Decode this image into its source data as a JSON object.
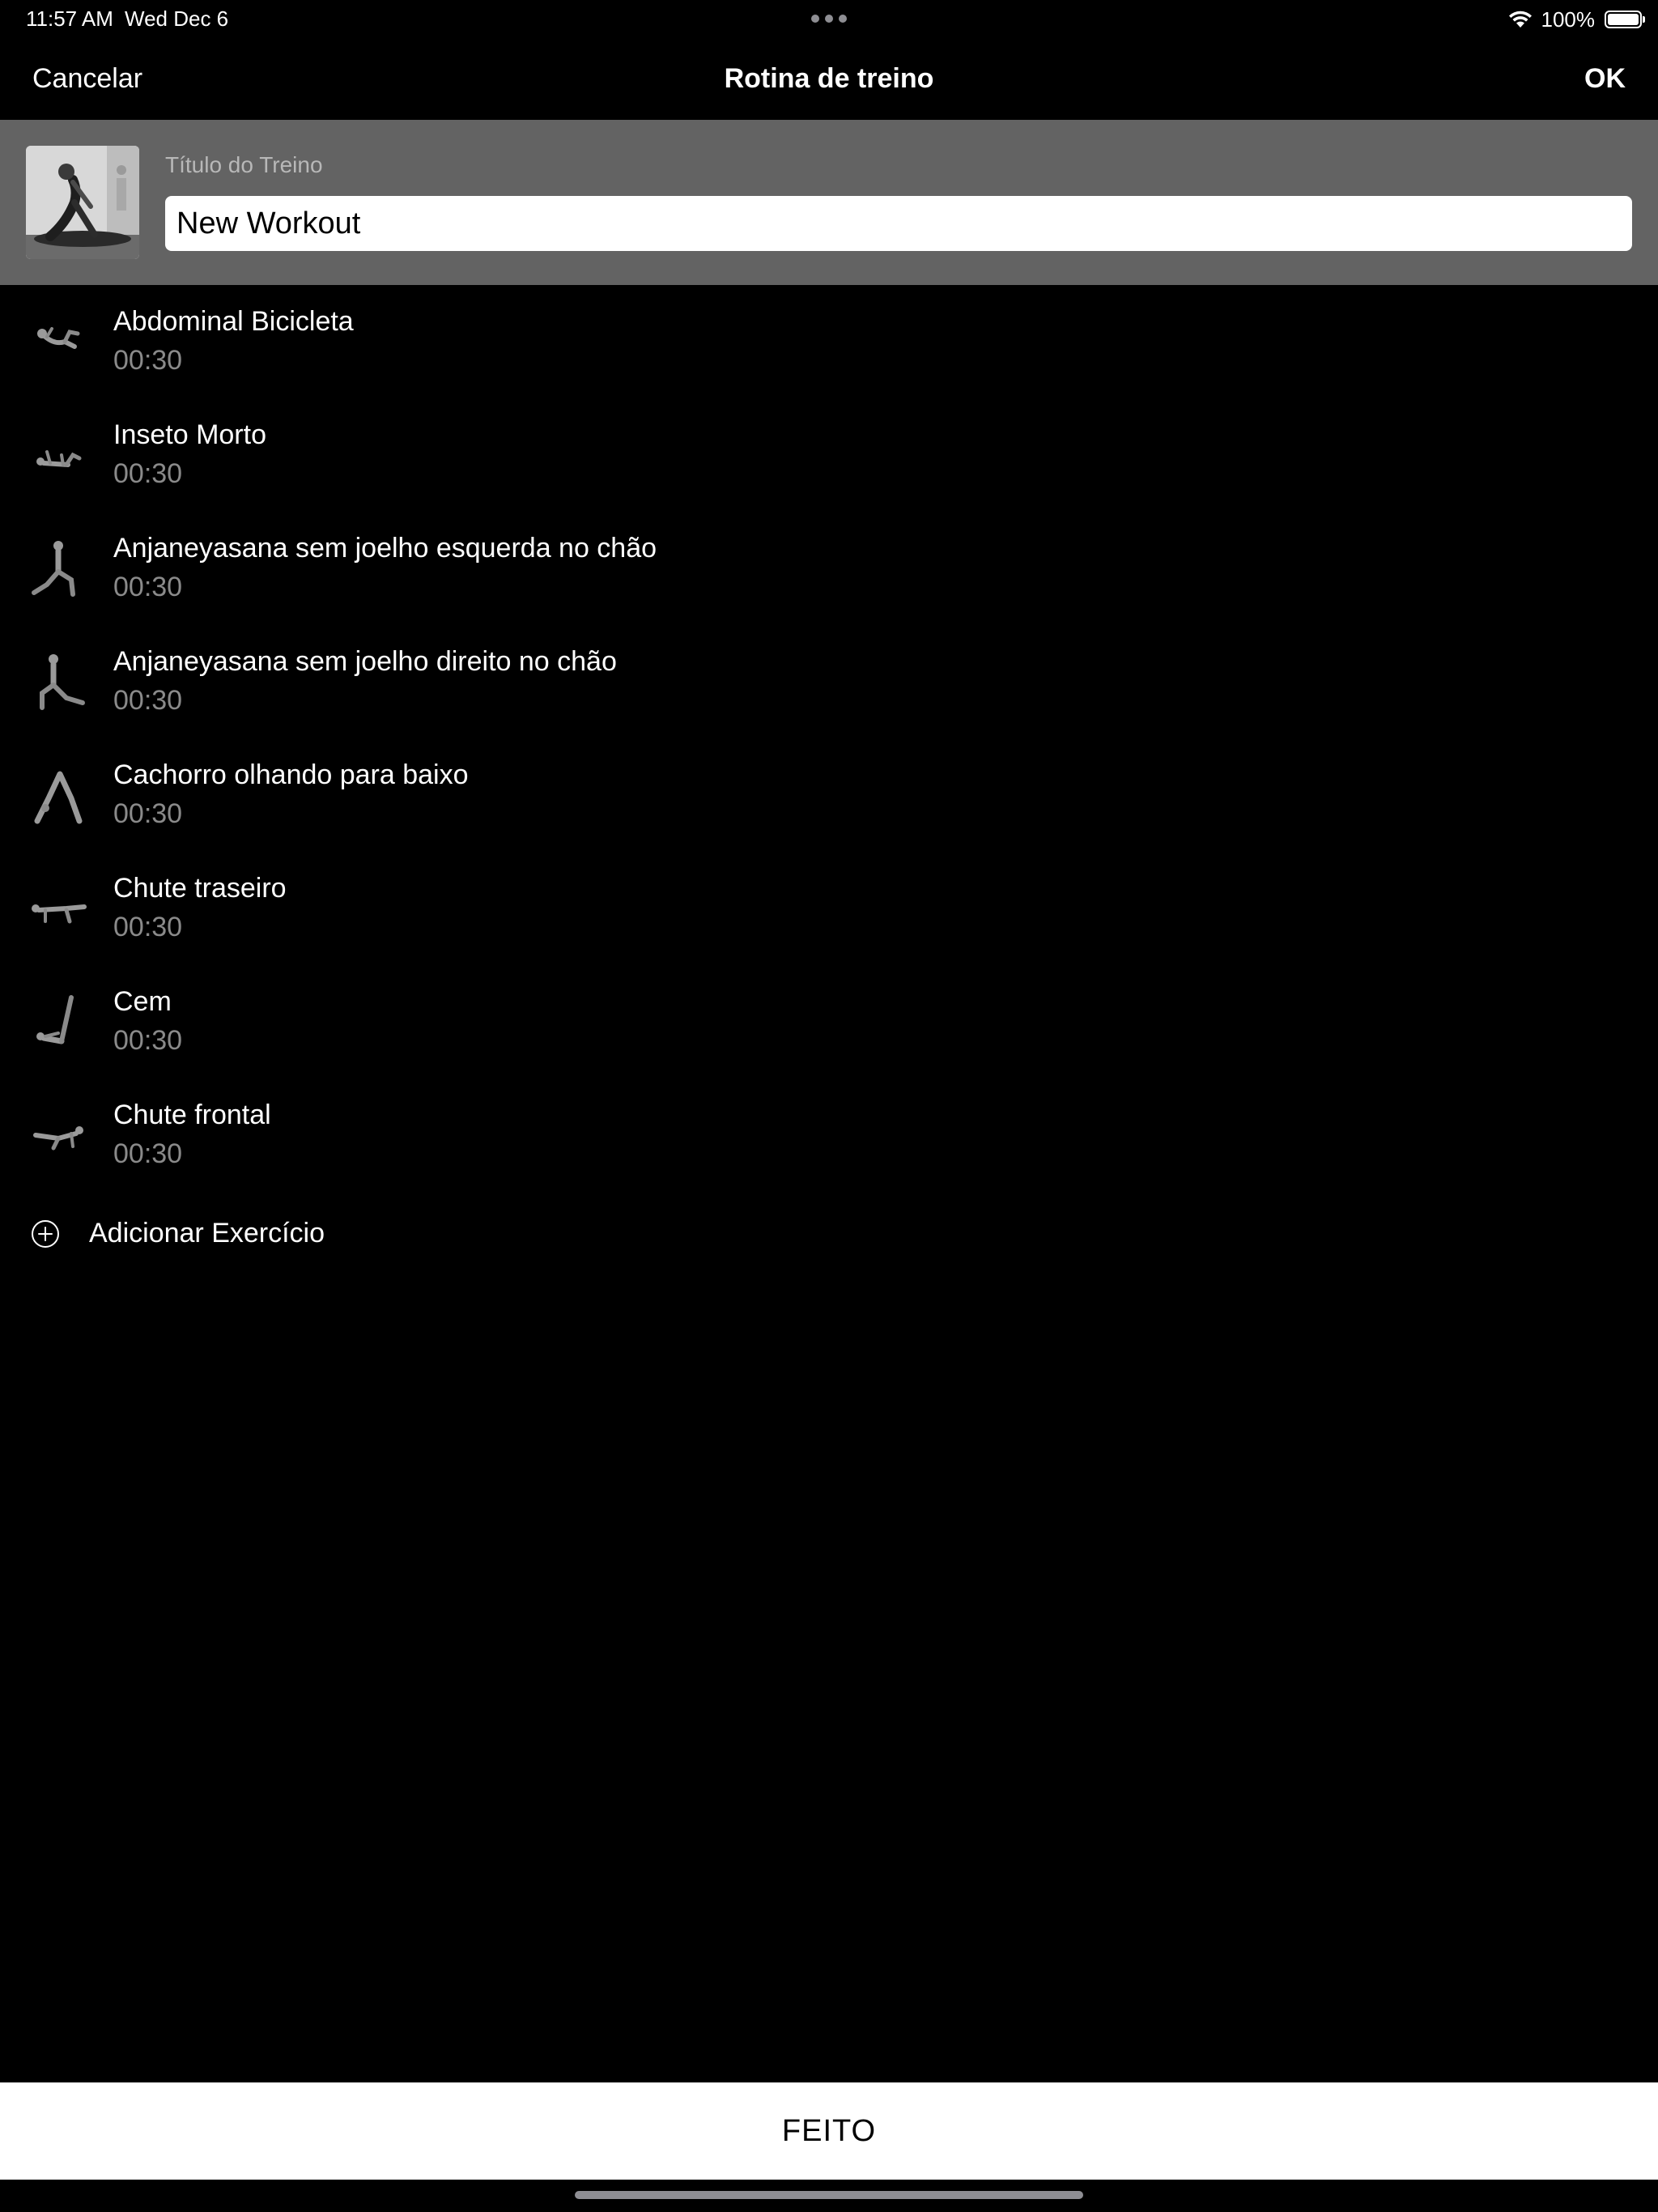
{
  "status_bar": {
    "time": "11:57 AM",
    "date": "Wed Dec 6",
    "battery_percent": "100%",
    "icons": [
      "wifi-icon",
      "battery-icon"
    ]
  },
  "nav": {
    "cancel_label": "Cancelar",
    "title": "Rotina de treino",
    "ok_label": "OK"
  },
  "header": {
    "title_label": "Título do Treino",
    "title_value": "New Workout",
    "thumbnail": "yoga-pose-image"
  },
  "exercises": [
    {
      "name": "Abdominal Bicicleta",
      "duration": "00:30",
      "icon": "bicycle-crunch-icon"
    },
    {
      "name": "Inseto Morto",
      "duration": "00:30",
      "icon": "dead-bug-icon"
    },
    {
      "name": "Anjaneyasana sem joelho esquerda no chão",
      "duration": "00:30",
      "icon": "lunge-left-icon"
    },
    {
      "name": "Anjaneyasana sem joelho direito no chão",
      "duration": "00:30",
      "icon": "lunge-right-icon"
    },
    {
      "name": "Cachorro olhando para baixo",
      "duration": "00:30",
      "icon": "downward-dog-icon"
    },
    {
      "name": "Chute traseiro",
      "duration": "00:30",
      "icon": "back-kick-icon"
    },
    {
      "name": "Cem",
      "duration": "00:30",
      "icon": "hundred-icon"
    },
    {
      "name": "Chute frontal",
      "duration": "00:30",
      "icon": "front-kick-icon"
    }
  ],
  "add_exercise_label": "Adicionar Exercício",
  "done_label": "FEITO",
  "colors": {
    "background": "#000000",
    "header_panel": "#636363",
    "secondary_text": "#8a8a8a",
    "label_text": "#b8b8b8",
    "button_bg": "#ffffff"
  }
}
